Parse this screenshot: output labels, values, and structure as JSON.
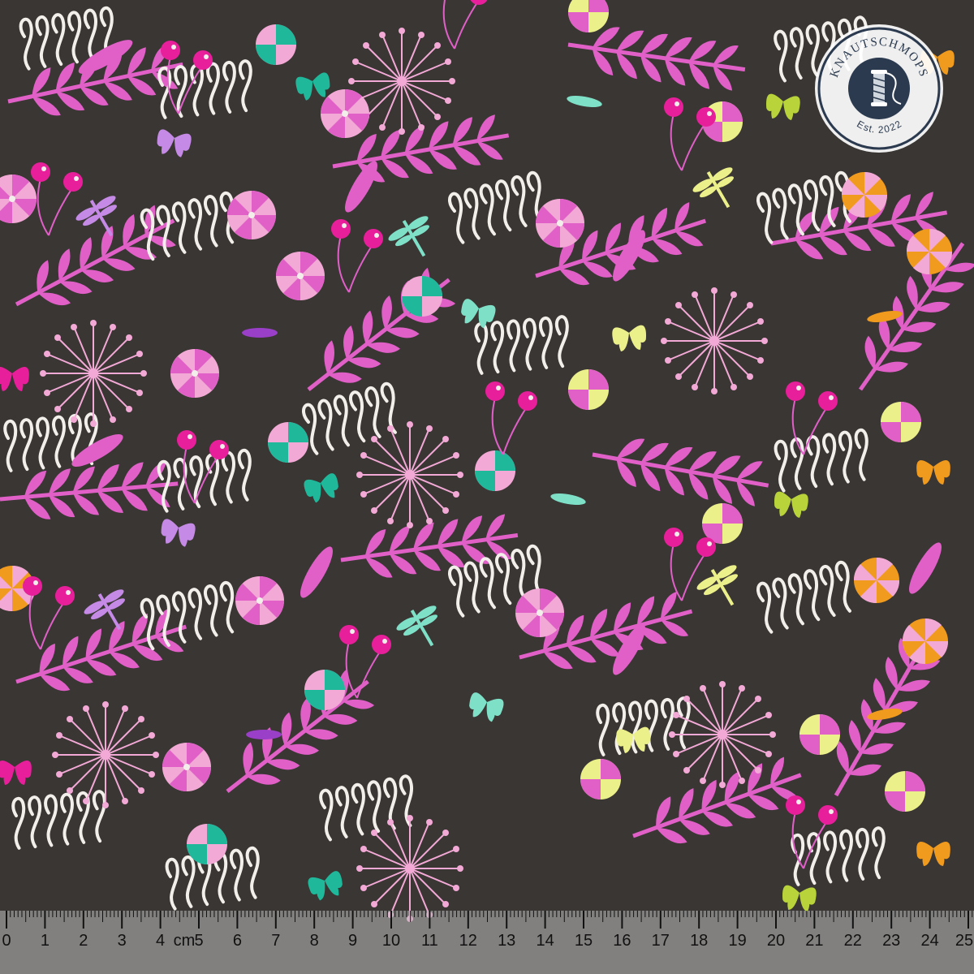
{
  "image": {
    "subject": "fabric-swatch",
    "background_color": "#3a3634",
    "motif_colors": {
      "pink": "#e060c8",
      "magenta": "#e81f9a",
      "lilac": "#c48ae6",
      "purple": "#9a3fc8",
      "mint": "#7fe0c8",
      "teal": "#1fb89a",
      "white": "#f2eeea",
      "lime": "#b8d43a",
      "yellow": "#ecf08a",
      "orange": "#f09a1e",
      "light_pink": "#f3a9d6"
    }
  },
  "logo": {
    "brand": "KNAUTSCHMOPS",
    "established": "Est. 2022",
    "icon": "thread-spool-icon"
  },
  "ruler": {
    "unit": "cm",
    "labels": [
      "0",
      "1",
      "2",
      "3",
      "4",
      "5",
      "6",
      "7",
      "8",
      "9",
      "10",
      "11",
      "12",
      "13",
      "14",
      "15",
      "16",
      "17",
      "18",
      "19",
      "20",
      "21",
      "22",
      "23",
      "24",
      "25"
    ]
  }
}
